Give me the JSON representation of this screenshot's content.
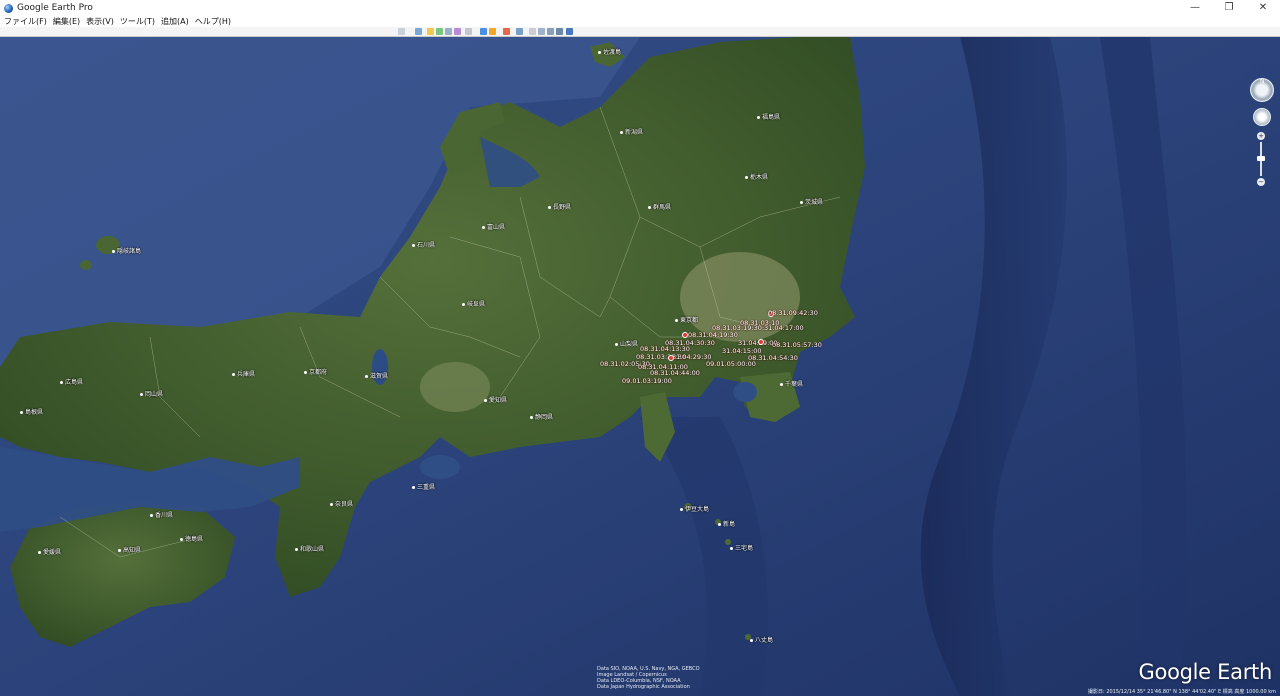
{
  "window": {
    "title": "Google Earth Pro",
    "minimize": "—",
    "maximize": "❐",
    "close": "✕"
  },
  "menu": [
    "ファイル(F)",
    "編集(E)",
    "表示(V)",
    "ツール(T)",
    "追加(A)",
    "ヘルプ(H)"
  ],
  "places": [
    {
      "id": "fukushima",
      "label": "福島県"
    },
    {
      "id": "niigata",
      "label": "新潟県"
    },
    {
      "id": "tochigi",
      "label": "栃木県"
    },
    {
      "id": "ibaraki",
      "label": "茨城県"
    },
    {
      "id": "gunma",
      "label": "群馬県"
    },
    {
      "id": "nagano",
      "label": "長野県"
    },
    {
      "id": "toyama",
      "label": "富山県"
    },
    {
      "id": "ishikawa",
      "label": "石川県"
    },
    {
      "id": "gifu",
      "label": "岐阜県"
    },
    {
      "id": "yamanashi",
      "label": "山梨県"
    },
    {
      "id": "tokyo",
      "label": "東京都"
    },
    {
      "id": "chiba",
      "label": "千葉県"
    },
    {
      "id": "shizuoka",
      "label": "静岡県"
    },
    {
      "id": "aichi",
      "label": "愛知県"
    },
    {
      "id": "shiga",
      "label": "滋賀県"
    },
    {
      "id": "kyoto",
      "label": "京都府"
    },
    {
      "id": "hyogo",
      "label": "兵庫県"
    },
    {
      "id": "okayama",
      "label": "岡山県"
    },
    {
      "id": "hiroshima",
      "label": "広島県"
    },
    {
      "id": "mie",
      "label": "三重県"
    },
    {
      "id": "nara",
      "label": "奈良県"
    },
    {
      "id": "wakayama",
      "label": "和歌山県"
    },
    {
      "id": "tokushima",
      "label": "徳島県"
    },
    {
      "id": "kagawa",
      "label": "香川県"
    },
    {
      "id": "ehime",
      "label": "愛媛県"
    },
    {
      "id": "kochi",
      "label": "高知県"
    },
    {
      "id": "sado",
      "label": "佐渡島"
    },
    {
      "id": "oki",
      "label": "隠岐諸島"
    },
    {
      "id": "izu-oshima",
      "label": "伊豆大島"
    },
    {
      "id": "niijima",
      "label": "新島"
    },
    {
      "id": "miyake",
      "label": "三宅島"
    },
    {
      "id": "hachijo",
      "label": "八丈島"
    },
    {
      "id": "shimane",
      "label": "島根県"
    }
  ],
  "tracks": [
    "08.31.09:42:30",
    "08.31.03:10",
    "08.31.03:19:30:31.04:17:00",
    "08.31.04:19:30",
    "08.31.04:30:30",
    "31.04:29:00",
    "08.31.04:13:30",
    "31.04:15:00",
    "08.31.04:54:30",
    "08.31.05:57:30",
    "08.31.03:31:30",
    "31.04:29:30",
    "09.01.05:00:00",
    "08.31.02:05:30",
    "08.31.04:11:00",
    "08.31.04:44:00",
    "09.01.03:19:00"
  ],
  "credits": [
    "Data SIO, NOAA, U.S. Navy, NGA, GEBCO",
    "Image Landsat / Copernicus",
    "Data LDEO-Columbia, NSF, NOAA",
    "Data Japan Hydrographic Association"
  ],
  "logo": "Google Earth",
  "status": {
    "date": "撮影日: 2015/12/14",
    "coords": "35° 21'46.80\" N 138° 44'02.40\" E 標高",
    "eye_alt": "高度 1000.00 km"
  },
  "nav": {
    "north": "N",
    "zoom_in": "+",
    "zoom_out": "−"
  },
  "colors": {
    "ocean": "#2a3d6e",
    "land": "#3f5a2a",
    "track_pin": "#e53a2c"
  }
}
